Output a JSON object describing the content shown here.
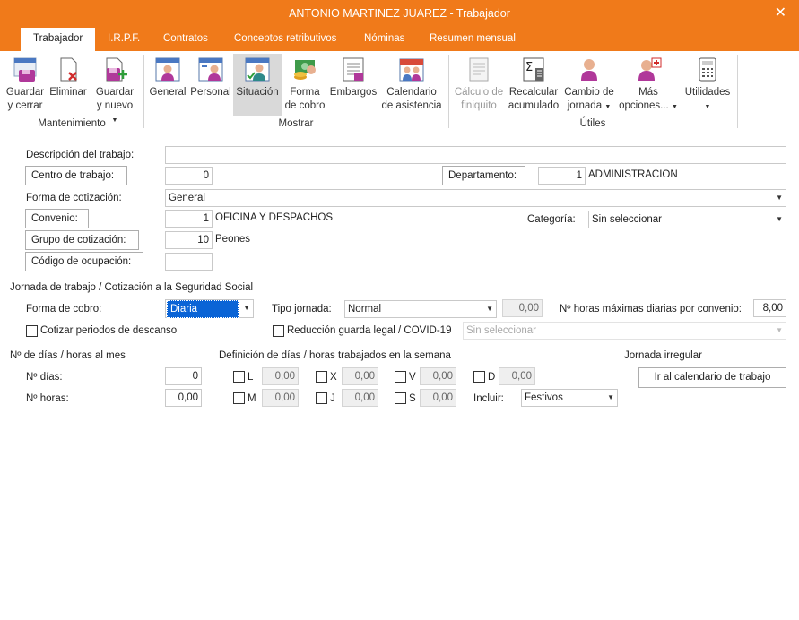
{
  "window": {
    "title": "ANTONIO MARTINEZ JUAREZ - Trabajador",
    "accent": "#f07a1a"
  },
  "tabs": [
    "Trabajador",
    "I.R.P.F.",
    "Contratos",
    "Conceptos retributivos",
    "Nóminas",
    "Resumen mensual"
  ],
  "ribbon": {
    "guardar_cerrar": [
      "Guardar",
      "y cerrar"
    ],
    "eliminar": "Eliminar",
    "guardar_nuevo": [
      "Guardar",
      "y nuevo"
    ],
    "general": "General",
    "personal": "Personal",
    "situacion": "Situación",
    "forma_cobro": [
      "Forma",
      "de cobro"
    ],
    "embargos": "Embargos",
    "calendario": [
      "Calendario",
      "de asistencia"
    ],
    "calculo_finiquito": [
      "Cálculo de",
      "finiquito"
    ],
    "recalcular": [
      "Recalcular",
      "acumulado"
    ],
    "cambio_jornada": [
      "Cambio de",
      "jornada"
    ],
    "mas_opciones": [
      "Más",
      "opciones..."
    ],
    "utilidades": "Utilidades",
    "groups": {
      "mantenimiento": "Mantenimiento",
      "mostrar": "Mostrar",
      "utiles": "Útiles"
    }
  },
  "form": {
    "descripcion_label": "Descripción del trabajo:",
    "descripcion_value": "",
    "centro_btn": "Centro de trabajo:",
    "centro_value": "0",
    "departamento_btn": "Departamento:",
    "departamento_value": "1",
    "departamento_name": "ADMINISTRACION",
    "forma_cotizacion_label": "Forma de cotización:",
    "forma_cotizacion_value": "General",
    "convenio_btn": "Convenio:",
    "convenio_value": "1",
    "convenio_name": "OFICINA Y DESPACHOS",
    "categoria_label": "Categoría:",
    "categoria_value": "Sin seleccionar",
    "grupo_btn": "Grupo de cotización:",
    "grupo_value": "10",
    "grupo_name": "Peones",
    "codigo_btn": "Código de ocupación:",
    "codigo_value": ""
  },
  "jornada": {
    "section": "Jornada de trabajo / Cotización a la Seguridad Social",
    "forma_cobro_label": "Forma de cobro:",
    "forma_cobro_value": "Diaria",
    "tipo_label": "Tipo jornada:",
    "tipo_value": "Normal",
    "tipo_num": "0,00",
    "max_label": "Nº horas máximas diarias por convenio:",
    "max_value": "8,00",
    "cotizar_label": "Cotizar periodos de descanso",
    "reduccion_label": "Reducción guarda legal / COVID-19",
    "reduccion_value": "Sin seleccionar"
  },
  "dias": {
    "section": "Nº de días / horas al mes",
    "dias_label": "Nº días:",
    "dias_value": "0",
    "horas_label": "Nº horas:",
    "horas_value": "0,00",
    "def_section": "Definición de días / horas trabajados en la semana",
    "L": "L",
    "M": "M",
    "X": "X",
    "J": "J",
    "V": "V",
    "S": "S",
    "D": "D",
    "val": "0,00",
    "incluir_label": "Incluir:",
    "incluir_value": "Festivos",
    "irregular_section": "Jornada irregular",
    "calendario_btn": "Ir al calendario de trabajo"
  }
}
